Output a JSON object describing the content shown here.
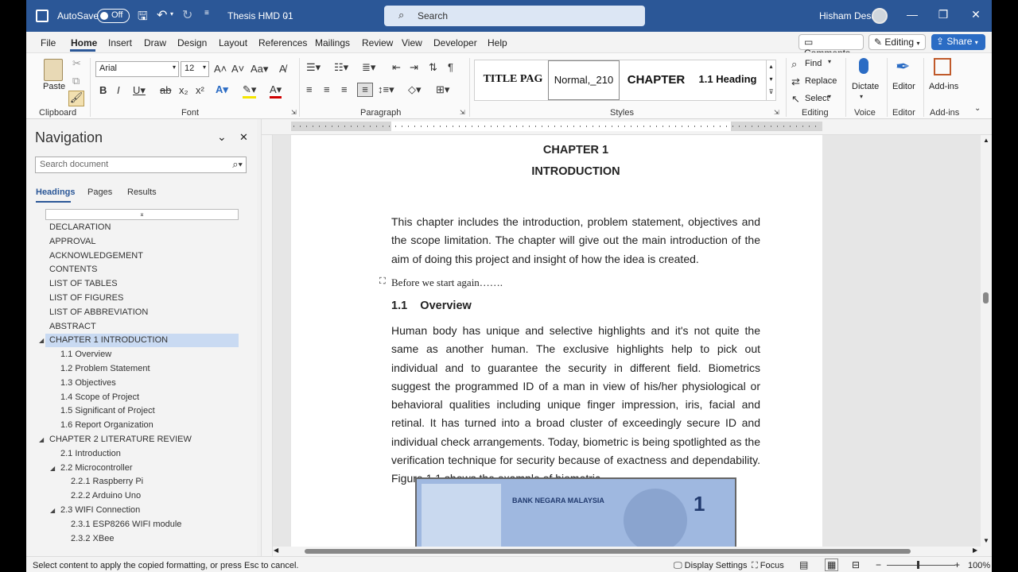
{
  "titlebar": {
    "autosave_label": "AutoSave",
    "autosave_state": "Off",
    "doc_title": "Thesis HMD 01",
    "search_placeholder": "Search",
    "user_name": "Hisham Desa"
  },
  "menu": {
    "items": [
      "File",
      "Home",
      "Insert",
      "Draw",
      "Design",
      "Layout",
      "References",
      "Mailings",
      "Review",
      "View",
      "Developer",
      "Help"
    ],
    "comments": "Comments",
    "editing": "Editing",
    "share": "Share"
  },
  "ribbon": {
    "clipboard": {
      "paste": "Paste",
      "label": "Clipboard"
    },
    "font": {
      "name": "Arial",
      "size": "12",
      "label": "Font"
    },
    "paragraph": {
      "label": "Paragraph"
    },
    "styles": {
      "items": [
        "TITLE PAG",
        "Normal,_210",
        "CHAPTER",
        "1.1 Heading"
      ],
      "label": "Styles"
    },
    "editing": {
      "find": "Find",
      "replace": "Replace",
      "select": "Select",
      "label": "Editing"
    },
    "voice": {
      "dictate": "Dictate",
      "label": "Voice"
    },
    "editor": {
      "editor": "Editor",
      "label": "Editor"
    },
    "addins": {
      "addins": "Add-ins",
      "label": "Add-ins"
    }
  },
  "navigation": {
    "title": "Navigation",
    "search_placeholder": "Search document",
    "tabs": [
      "Headings",
      "Pages",
      "Results"
    ],
    "headings": [
      {
        "text": "DECLARATION",
        "level": 1
      },
      {
        "text": "APPROVAL",
        "level": 1
      },
      {
        "text": "ACKNOWLEDGEMENT",
        "level": 1
      },
      {
        "text": "CONTENTS",
        "level": 1
      },
      {
        "text": "LIST OF TABLES",
        "level": 1
      },
      {
        "text": "LIST OF FIGURES",
        "level": 1
      },
      {
        "text": "LIST OF ABBREVIATION",
        "level": 1
      },
      {
        "text": "ABSTRACT",
        "level": 1
      },
      {
        "text": "CHAPTER 1   INTRODUCTION",
        "level": 1,
        "selected": true,
        "expanded": true
      },
      {
        "text": "1.1 Overview",
        "level": 2
      },
      {
        "text": "1.2 Problem Statement",
        "level": 2
      },
      {
        "text": "1.3 Objectives",
        "level": 2
      },
      {
        "text": "1.4 Scope of Project",
        "level": 2
      },
      {
        "text": "1.5 Significant of Project",
        "level": 2
      },
      {
        "text": "1.6 Report Organization",
        "level": 2
      },
      {
        "text": "CHAPTER 2   LITERATURE REVIEW",
        "level": 1,
        "expanded": true
      },
      {
        "text": "2.1 Introduction",
        "level": 2
      },
      {
        "text": "2.2 Microcontroller",
        "level": 2,
        "expanded": true
      },
      {
        "text": "2.2.1 Raspberry Pi",
        "level": 3
      },
      {
        "text": "2.2.2 Arduino Uno",
        "level": 3
      },
      {
        "text": "2.3 WIFI Connection",
        "level": 2,
        "expanded": true
      },
      {
        "text": "2.3.1 ESP8266 WIFI module",
        "level": 3
      },
      {
        "text": "2.3.2 XBee",
        "level": 3
      }
    ]
  },
  "document": {
    "chapter": "CHAPTER 1",
    "chapter_title": "INTRODUCTION",
    "intro_para": "This chapter includes the introduction, problem statement, objectives and the scope limitation. The chapter will give out the main introduction of the aim of doing this project and insight of how the idea is created.",
    "before_line": "Before we start again…….",
    "section_num": "1.1",
    "section_title": "Overview",
    "overview_para": "Human body has unique and selective highlights and it's not quite the same as another human. The exclusive highlights help to pick out individual and to guarantee the security in different field. Biometrics suggest the programmed ID of a man in view of his/her physiological or behavioral qualities including unique finger impression, iris, facial and retinal. It has turned into a broad cluster of exceedingly secure ID and individual check arrangements. Today, biometric is being spotlighted as the verification technique for security because of exactness and dependability. Figure 1.1 shows the example of biometric.",
    "figure_text": "BANK NEGARA MALAYSIA",
    "figure_value": "1"
  },
  "status": {
    "message": "Select content to apply the copied formatting, or press Esc to cancel.",
    "display_settings": "Display Settings",
    "focus": "Focus",
    "zoom": "100%"
  }
}
